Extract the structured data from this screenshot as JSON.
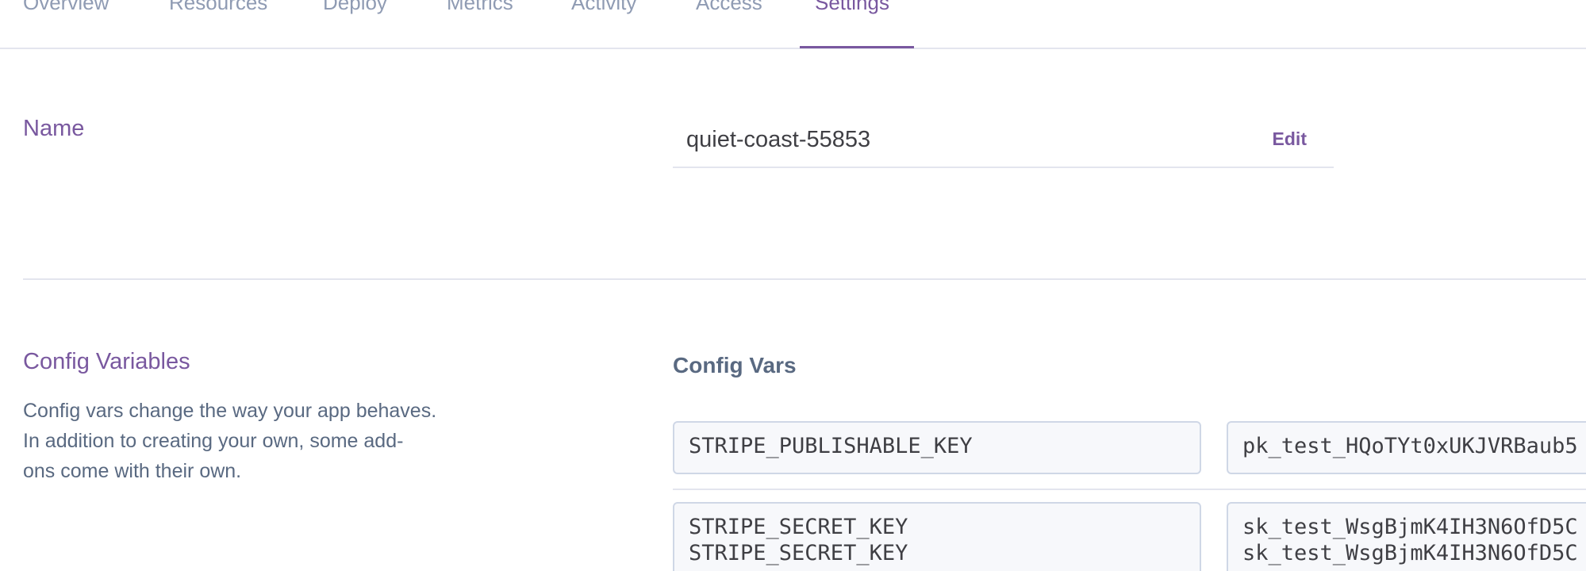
{
  "tabs": [
    {
      "label": "Overview"
    },
    {
      "label": "Resources"
    },
    {
      "label": "Deploy"
    },
    {
      "label": "Metrics"
    },
    {
      "label": "Activity"
    },
    {
      "label": "Access"
    },
    {
      "label": "Settings",
      "active": true
    }
  ],
  "name_section": {
    "title": "Name",
    "value": "quiet-coast-55853",
    "edit_label": "Edit"
  },
  "config_section": {
    "title": "Config Variables",
    "description_lines": [
      "Config vars change the way your app behaves.",
      "In addition to creating your own, some add-",
      "ons come with their own."
    ],
    "subheading": "Config Vars",
    "vars": [
      {
        "key": "STRIPE_PUBLISHABLE_KEY",
        "value": "pk_test_HQoTYt0xUKJVRBaub5"
      },
      {
        "key": "STRIPE_SECRET_KEY\nSTRIPE_SECRET_KEY",
        "value": "sk_test_WsgBjmK4IH3N6OfD5C\nsk_test_WsgBjmK4IH3N6OfD5C"
      }
    ]
  },
  "colors": {
    "accent": "#79589f",
    "muted_tab": "#8f9bb3",
    "body_text": "#596981",
    "divider": "#e3e5ee"
  }
}
